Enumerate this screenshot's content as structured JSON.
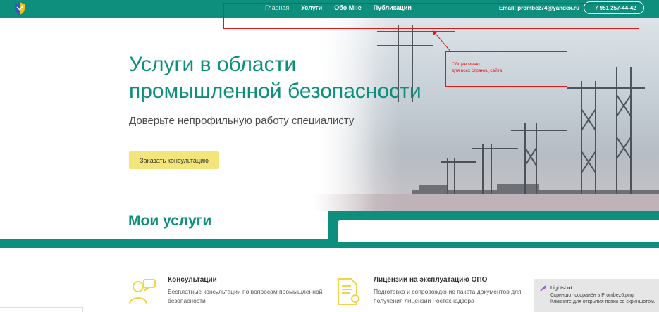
{
  "nav": {
    "items": [
      {
        "label": "Главная"
      },
      {
        "label": "Услуги"
      },
      {
        "label": "Обо Мне"
      },
      {
        "label": "Публикации"
      }
    ],
    "email": "Email: prombez74@yandex.ru",
    "phone": "+7 951 257-44-42"
  },
  "hero": {
    "title": "Услуги в области промышленной безопасности",
    "subtitle": "Доверьте непрофильную работу специалисту",
    "cta_label": "Заказать консультацию"
  },
  "services": {
    "section_title": "Мои услуги",
    "cards": [
      {
        "title": "Консультации",
        "text": "Бесплатные консультации по вопросам промышленной безопасности",
        "icon": "consultation-icon"
      },
      {
        "title": "Лицензии на эксплуатацию ОПО",
        "text": "Подготовка и сопровождение пакета документов для получения лицензии Ростехнадзора",
        "icon": "license-document-icon"
      }
    ]
  },
  "annotation": {
    "line1": "Общее меню",
    "line2": "для всех страниц сайта"
  },
  "toast": {
    "title": "Lightshot",
    "text": "Скриншот сохранён в Prombez6.png. Кликните для открытия папки со скриншотом."
  },
  "colors": {
    "brand_green": "#0e8f7d",
    "cta_yellow": "#f3e57a",
    "annotation_red": "#e01818"
  }
}
